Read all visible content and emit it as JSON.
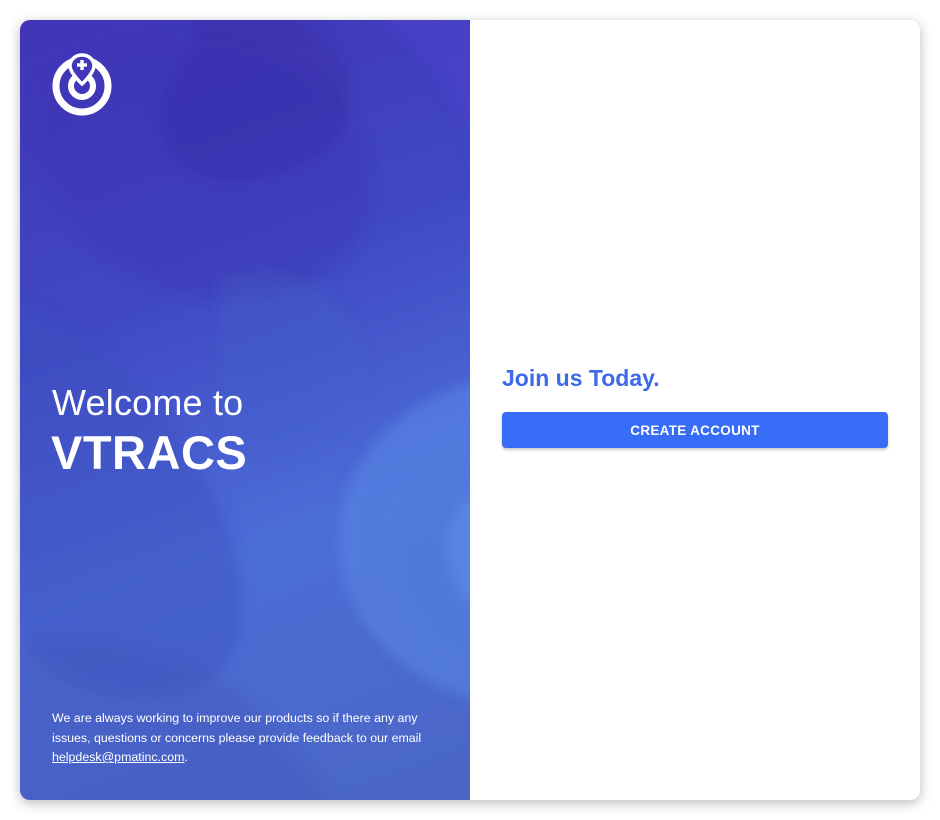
{
  "hero": {
    "logo_icon": "location-pin-power-icon",
    "welcome_text": "Welcome to",
    "brand_name": "VTRACS",
    "feedback_text": "We are always working to improve our products so if there any any issues, questions or concerns please provide feedback to our email ",
    "feedback_email": "helpdesk@pmatinc.com",
    "feedback_suffix": "."
  },
  "signup": {
    "title": "Join us Today.",
    "create_account_label": "CREATE ACCOUNT"
  },
  "colors": {
    "hero_gradient_start": "#4034b8",
    "hero_gradient_end": "#4d6ed8",
    "accent_blue": "#366cf6",
    "title_blue": "#3d69ea"
  }
}
